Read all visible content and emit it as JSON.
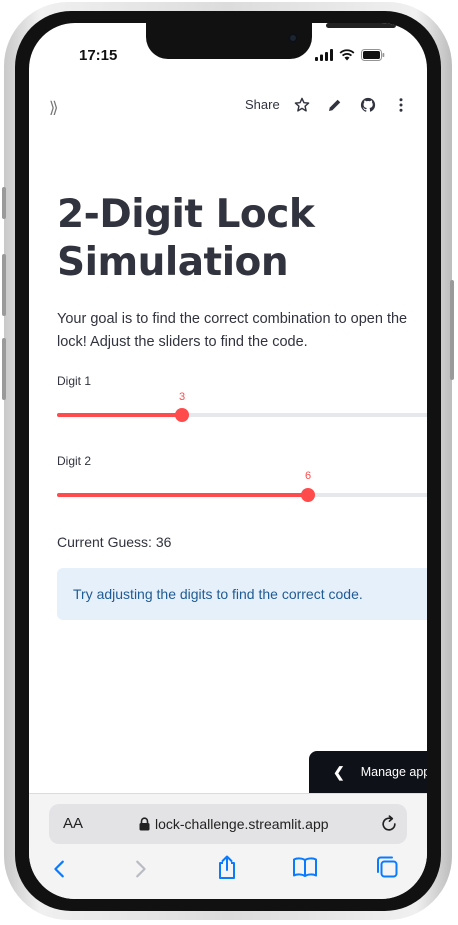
{
  "status_bar": {
    "time": "17:15"
  },
  "toolbar": {
    "share_label": "Share",
    "icons": [
      "expand-sidebar-icon",
      "star-icon",
      "pencil-icon",
      "github-icon",
      "more-vert-icon"
    ]
  },
  "page": {
    "title_line1": "2-Digit Lock",
    "title_line2": "Simulation",
    "description_line1": "Your goal is to find the correct combination to open the",
    "description_line2": "lock!  Adjust the sliders to find the code."
  },
  "sliders": [
    {
      "label": "Digit 1",
      "value": "3",
      "min": 0,
      "max": 9,
      "fraction": 0.333
    },
    {
      "label": "Digit 2",
      "value": "6",
      "min": 0,
      "max": 9,
      "fraction": 0.667
    }
  ],
  "guess_text": "Current Guess: 36",
  "info_text": "Try adjusting the digits to find the correct code.",
  "manage_app_label": "Manage app",
  "browser": {
    "aa_label": "AA",
    "url": "lock-challenge.streamlit.app"
  },
  "colors": {
    "accent": "#ff4b4b",
    "info_bg": "#e6f0fb",
    "info_text": "#1f5b94",
    "text": "#31333f",
    "ios_blue": "#0a7aff"
  }
}
